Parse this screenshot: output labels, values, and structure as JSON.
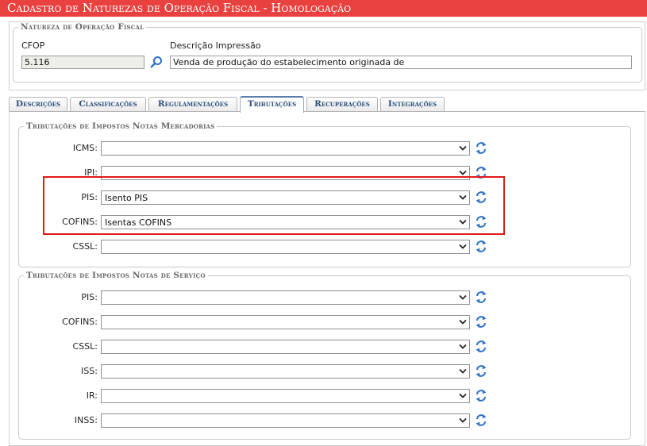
{
  "window": {
    "title": "Cadastro de Naturezas de Operação Fiscal  - Homologação"
  },
  "natureza": {
    "legend": "Natureza de Operação Fiscal",
    "cfop_label": "CFOP",
    "cfop_value": "5.116",
    "descricao_label": "Descrição Impressão",
    "descricao_value": "Venda de produção do estabelecimento originada de"
  },
  "tabs": [
    {
      "label": "Descrições",
      "active": false
    },
    {
      "label": "Classificações",
      "active": false
    },
    {
      "label": "Regulamentações",
      "active": false
    },
    {
      "label": "Tributações",
      "active": true
    },
    {
      "label": "Recuperações",
      "active": false
    },
    {
      "label": "Integrações",
      "active": false
    }
  ],
  "mercadorias": {
    "legend": "Tributações de Impostos Notas Mercadorias",
    "rows": [
      {
        "label": "ICMS:",
        "value": ""
      },
      {
        "label": "IPI:",
        "value": ""
      },
      {
        "label": "PIS:",
        "value": "Isento PIS"
      },
      {
        "label": "COFINS:",
        "value": "Isentas COFINS"
      },
      {
        "label": "CSSL:",
        "value": ""
      }
    ]
  },
  "servico": {
    "legend": "Tributações de Impostos Notas de Serviço",
    "rows": [
      {
        "label": "PIS:",
        "value": ""
      },
      {
        "label": "COFINS:",
        "value": ""
      },
      {
        "label": "CSSL:",
        "value": ""
      },
      {
        "label": "ISS:",
        "value": ""
      },
      {
        "label": "IR:",
        "value": ""
      },
      {
        "label": "INSS:",
        "value": ""
      }
    ]
  },
  "colors": {
    "title_bar": "#e8413f",
    "highlight": "#e11a1a",
    "refresh_icon": "#2a6fc9"
  },
  "icons": {
    "search": "magnifier-icon",
    "refresh": "refresh-icon",
    "dropdown": "chevron-down-icon"
  }
}
